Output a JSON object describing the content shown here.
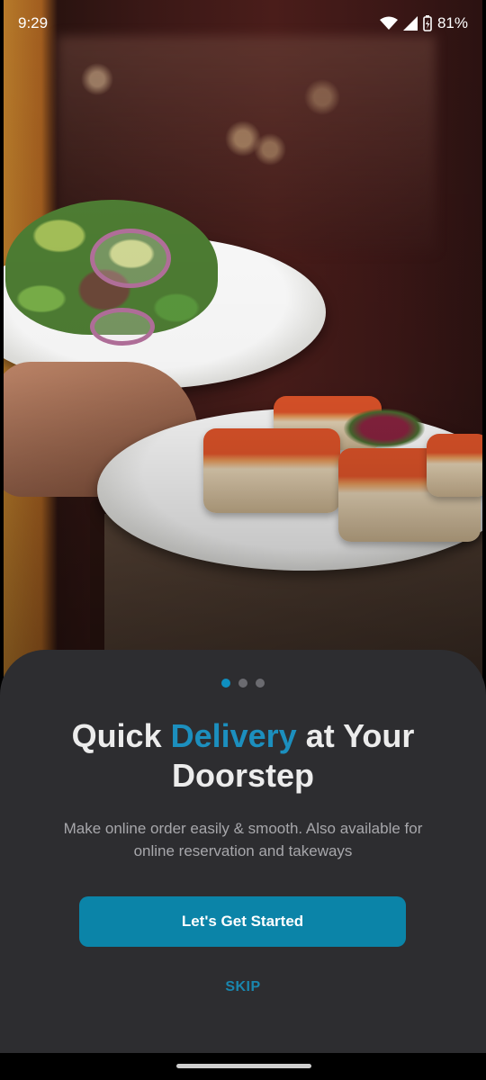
{
  "status_bar": {
    "time": "9:29",
    "battery": "81%",
    "icons": [
      "wifi-icon",
      "signal-icon",
      "battery-charging-icon"
    ]
  },
  "hero": {
    "image": "restaurant-food-photo"
  },
  "onboarding": {
    "pager": {
      "active_index": 0,
      "count": 3
    },
    "title_part1": "Quick ",
    "title_highlight": "Delivery",
    "title_part2": " at Your Doorstep",
    "subtitle": "Make online order easily & smooth. Also available for online reservation and takeways",
    "cta_label": "Let's Get Started",
    "skip_label": "SKIP"
  },
  "colors": {
    "accent": "#1c8fbe",
    "button": "#0b84a8",
    "sheet": "#2d2d30"
  }
}
